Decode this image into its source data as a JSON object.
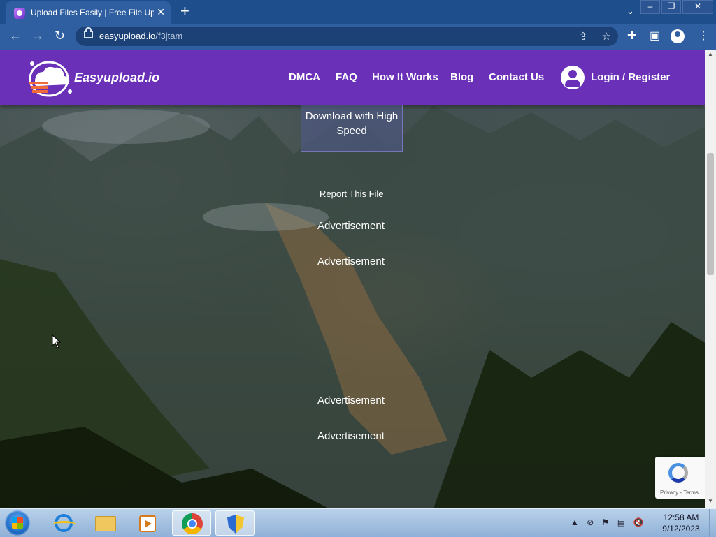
{
  "browser": {
    "tab_title": "Upload Files Easily | Free File Upl",
    "tab_close": "✕",
    "new_tab": "+",
    "url_host": "easyupload.io",
    "url_path": "/f3jtam"
  },
  "site": {
    "brand": "Easyupload.io",
    "nav": [
      "DMCA",
      "FAQ",
      "How It Works",
      "Blog",
      "Contact Us"
    ],
    "login": "Login / Register"
  },
  "content": {
    "download_label": "Download with High Speed",
    "report_label": "Report This File",
    "ad1": "Advertisement",
    "ad2": "Advertisement",
    "ad3": "Advertisement",
    "ad4": "Advertisement"
  },
  "recaptcha": {
    "text": "Privacy - Terms"
  },
  "taskbar": {
    "time": "12:58 AM",
    "date": "9/12/2023"
  },
  "colors": {
    "header": "#6a30b8",
    "titlebar": "#1f4e8c",
    "toolbar": "#2f5fa0"
  }
}
